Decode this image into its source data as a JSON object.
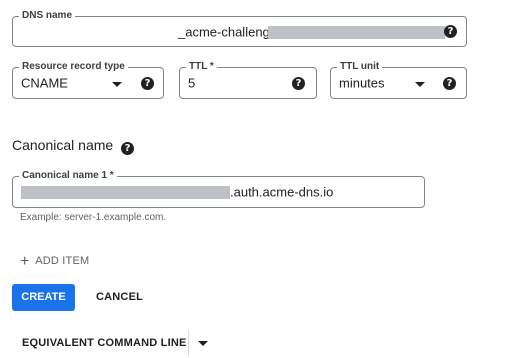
{
  "dns_name": {
    "label": "DNS name",
    "value": "_acme-challenge.",
    "help_icon": "help-icon"
  },
  "resource_record_type": {
    "label": "Resource record type",
    "value": "CNAME",
    "help_icon": "help-icon"
  },
  "ttl": {
    "label": "TTL *",
    "value": "5",
    "help_icon": "help-icon"
  },
  "ttl_unit": {
    "label": "TTL unit",
    "value": "minutes",
    "help_icon": "help-icon"
  },
  "canonical_section": {
    "title": "Canonical name"
  },
  "canonical_name_1": {
    "label": "Canonical name 1 *",
    "value": ".auth.acme-dns.io",
    "hint": "Example: server-1.example.com."
  },
  "add_item": {
    "icon": "+",
    "label": "ADD ITEM"
  },
  "actions": {
    "create": "CREATE",
    "cancel": "CANCEL",
    "equivalent_command_line": "EQUIVALENT COMMAND LINE"
  },
  "colors": {
    "primary": "#1a73e8",
    "border": "#80868b",
    "redaction": "#bdc1c6"
  }
}
